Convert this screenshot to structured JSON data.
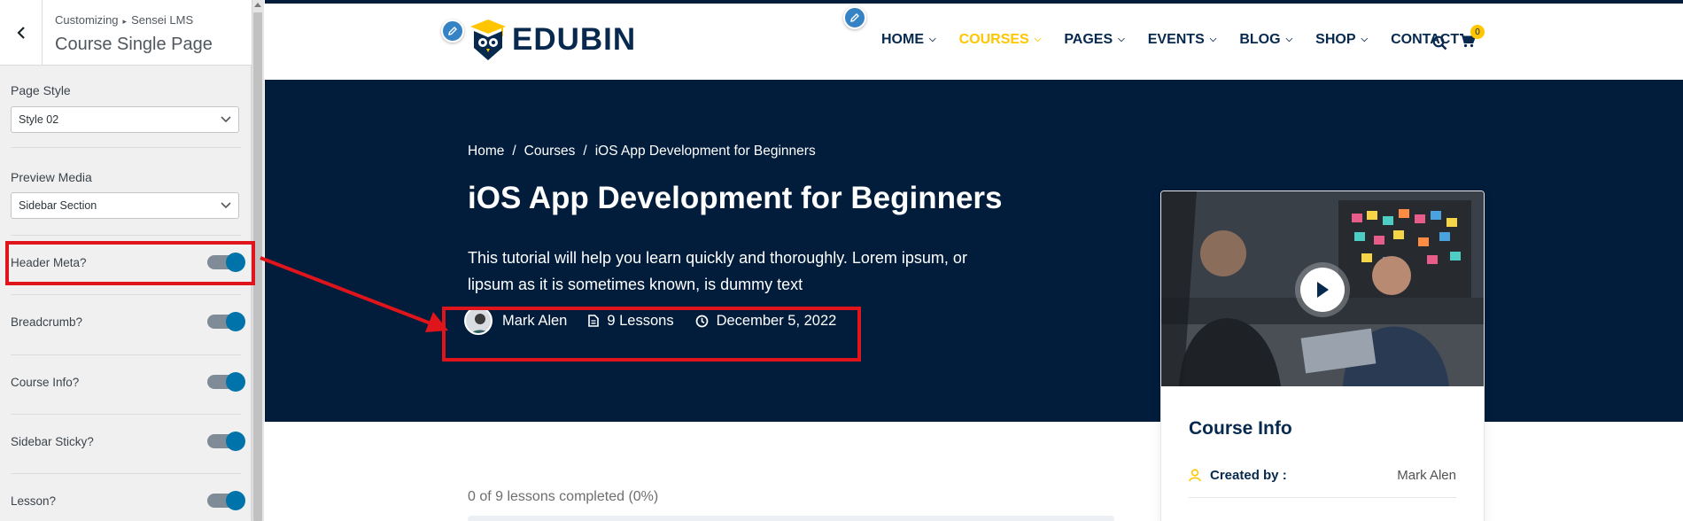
{
  "customizer": {
    "breadcrumb_root": "Customizing",
    "breadcrumb_sep": "▸",
    "breadcrumb_section": "Sensei LMS",
    "panel_title": "Course Single Page",
    "page_style": {
      "label": "Page Style",
      "value": "Style 02"
    },
    "preview_media": {
      "label": "Preview Media",
      "value": "Sidebar Section"
    },
    "toggles": [
      {
        "label": "Header Meta?",
        "enabled": true
      },
      {
        "label": "Breadcrumb?",
        "enabled": true
      },
      {
        "label": "Course Info?",
        "enabled": true
      },
      {
        "label": "Sidebar Sticky?",
        "enabled": true
      },
      {
        "label": "Lesson?",
        "enabled": true
      }
    ],
    "toggle_on_color": "#0073aa"
  },
  "site": {
    "logo_text": "EDUBIN",
    "nav": [
      {
        "label": "HOME",
        "has_dropdown": true,
        "active": false
      },
      {
        "label": "COURSES",
        "has_dropdown": true,
        "active": true
      },
      {
        "label": "PAGES",
        "has_dropdown": true,
        "active": false
      },
      {
        "label": "EVENTS",
        "has_dropdown": true,
        "active": false
      },
      {
        "label": "BLOG",
        "has_dropdown": true,
        "active": false
      },
      {
        "label": "SHOP",
        "has_dropdown": true,
        "active": false
      },
      {
        "label": "CONTACT",
        "has_dropdown": false,
        "active": false
      }
    ],
    "cart_count": "0",
    "colors": {
      "navy": "#021d3b",
      "accent": "#ffc600",
      "annotation": "#e0151b"
    }
  },
  "hero": {
    "breadcrumb": [
      "Home",
      "Courses",
      "iOS App Development for Beginners"
    ],
    "breadcrumb_sep": "/",
    "title": "iOS App Development for Beginners",
    "description_line1": "This tutorial will help you learn quickly and thoroughly. Lorem ipsum, or",
    "description_line2": "lipsum as it is sometimes known, is dummy text",
    "meta": {
      "author": "Mark Alen",
      "lessons": "9 Lessons",
      "date": "December 5, 2022"
    }
  },
  "course_info": {
    "title": "Course Info",
    "created_by_label": "Created by :",
    "created_by_value": "Mark Alen"
  },
  "progress": {
    "text": "0 of 9 lessons completed (0%)",
    "fraction": 0
  }
}
